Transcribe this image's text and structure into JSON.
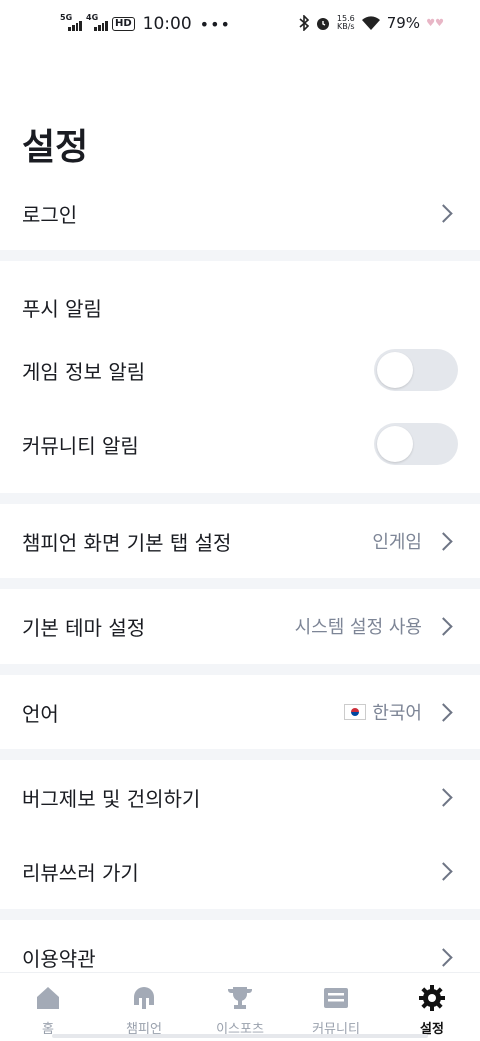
{
  "status_bar": {
    "net1": "5G",
    "net2": "4G",
    "hd": "HD",
    "time": "10:00",
    "more": "•••",
    "speed_top": "15.6",
    "speed_bottom": "KB/s",
    "battery": "79%"
  },
  "page_title": "설정",
  "rows": {
    "login": "로그인",
    "push_header": "푸시 알림",
    "game_info_alert": "게임 정보 알림",
    "community_alert": "커뮤니티 알림",
    "champion_tab": "챔피언 화면 기본 탭 설정",
    "champion_tab_value": "인게임",
    "theme": "기본 테마 설정",
    "theme_value": "시스템 설정 사용",
    "language": "언어",
    "language_value": "한국어",
    "bug_report": "버그제보 및 건의하기",
    "review": "리뷰쓰러 가기",
    "terms": "이용약관"
  },
  "toggles": {
    "game_info_alert_on": false,
    "community_alert_on": false
  },
  "tabbar": [
    {
      "label": "홈",
      "icon": "home-icon"
    },
    {
      "label": "챔피언",
      "icon": "helmet-icon"
    },
    {
      "label": "이스포츠",
      "icon": "trophy-icon"
    },
    {
      "label": "커뮤니티",
      "icon": "community-icon"
    },
    {
      "label": "설정",
      "icon": "gear-icon"
    }
  ],
  "colors": {
    "accent_text": "#1a1c22",
    "muted": "#7d8596",
    "separator": "#f3f5f8",
    "toggle_off": "#e4e7ec",
    "tab_inactive": "#9aa1ad"
  }
}
